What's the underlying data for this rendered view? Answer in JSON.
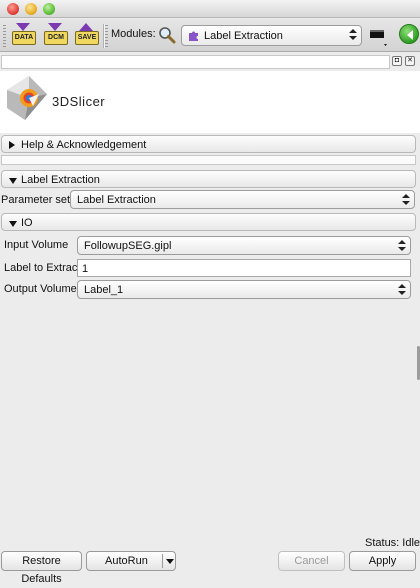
{
  "toolbar": {
    "data_button": "DATA",
    "dcm_button": "DCM",
    "save_button": "SAVE",
    "modules_label": "Modules:",
    "module_selected": "Label Extraction"
  },
  "logo": {
    "text": "3DSlicer"
  },
  "sections": {
    "help": "Help & Acknowledgement",
    "label_extraction": "Label Extraction",
    "io": "IO"
  },
  "parameter_set": {
    "label": "Parameter set:",
    "value": "Label Extraction"
  },
  "io": {
    "input_volume_label": "Input Volume",
    "input_volume_value": "FollowupSEG.gipl",
    "label_to_extract_label": "Label to Extract",
    "label_to_extract_value": "1",
    "output_volume_label": "Output Volume",
    "output_volume_value": "Label_1"
  },
  "status": {
    "text": "Status: Idle"
  },
  "buttons": {
    "restore_defaults": "Restore Defaults",
    "autorun": "AutoRun",
    "cancel": "Cancel",
    "apply": "Apply"
  },
  "colors": {
    "accent_purple": "#7b3ab0",
    "back_green": "#2e9e22",
    "puzzle_purple": "#8a55c8"
  }
}
